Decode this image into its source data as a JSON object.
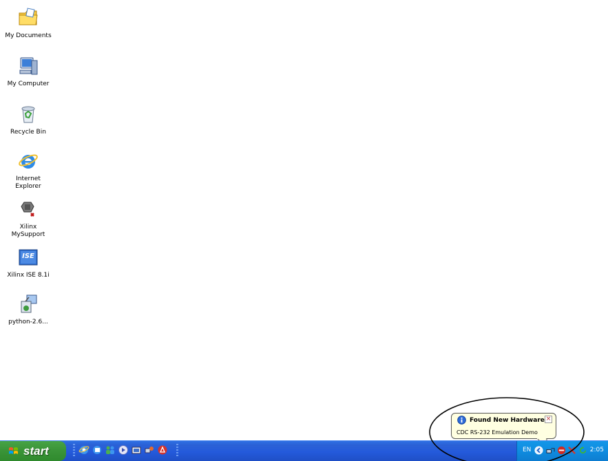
{
  "desktop": {
    "icons": [
      {
        "label": "My Documents",
        "icon": "my-documents-icon"
      },
      {
        "label": "My Computer",
        "icon": "my-computer-icon"
      },
      {
        "label": "Recycle Bin",
        "icon": "recycle-bin-icon"
      },
      {
        "label": "Internet\nExplorer",
        "icon": "internet-explorer-icon"
      },
      {
        "label": "Xilinx\nMySupport",
        "icon": "xilinx-mysupport-icon"
      },
      {
        "label": "Xilinx ISE 8.1i",
        "icon": "xilinx-ise-icon",
        "badge": "ISE"
      },
      {
        "label": "python-2.6...",
        "icon": "python-installer-icon"
      }
    ]
  },
  "taskbar": {
    "start_label": "start",
    "quick_launch": [
      "ie-icon",
      "email-icon",
      "messenger-icon",
      "media-icon",
      "folder-icon",
      "network-icon",
      "acrobat-icon"
    ],
    "tray": {
      "language": "EN",
      "icons": [
        "back-arrow-icon",
        "network-icon",
        "security-icon",
        "usb-icon",
        "refresh-icon"
      ],
      "clock": "2:05"
    }
  },
  "balloon": {
    "title": "Found New Hardware",
    "body": "CDC RS-232 Emulation Demo",
    "close_glyph": "×"
  },
  "colors": {
    "taskbar": "#245adb",
    "start": "#3c963a",
    "tray": "#0f8ce0",
    "balloon": "#ffffe1"
  }
}
